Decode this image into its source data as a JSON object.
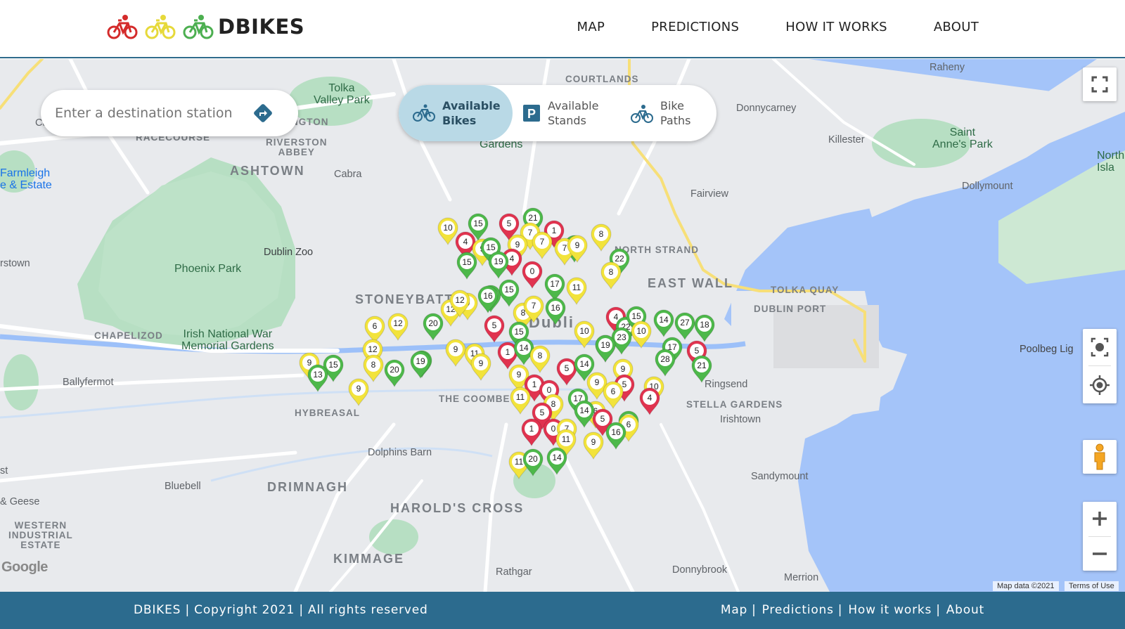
{
  "header": {
    "brand": "DBIKES",
    "logo_bike_colors": [
      "#d42b2b",
      "#e6d93a",
      "#4caf50"
    ],
    "nav": [
      "MAP",
      "PREDICTIONS",
      "HOW IT WORKS",
      "ABOUT"
    ]
  },
  "search": {
    "placeholder": "Enter a destination station",
    "icon": "directions-icon"
  },
  "layers": [
    {
      "icon": "bicycle-icon",
      "label_line1": "Available",
      "label_line2": "Bikes",
      "active": true
    },
    {
      "icon": "parking-icon",
      "label_line1": "Available",
      "label_line2": "Stands",
      "active": false
    },
    {
      "icon": "bike-path-icon",
      "label_line1": "Bike",
      "label_line2": "Paths",
      "active": false
    }
  ],
  "marker_colors": {
    "red": "#e0334f",
    "yellow": "#f2e33b",
    "green": "#4db84a"
  },
  "map_labels": {
    "courtlands": "COURTLANDS",
    "raheny": "Raheny",
    "tolka_valley": "Tolka\nValley Park",
    "donnycarney": "Donnycarney",
    "killester": "Killester",
    "saint_annes": "Saint\nAnne's Park",
    "north_island": "North\nIsla",
    "dollymount": "Dollymount",
    "racecourse": "RACECOURSE",
    "riverston": "RIVERSTON\nABBEY",
    "ashtown": "ASHTOWN",
    "cabra": "Cabra",
    "farmleigh": "Farmleigh\ne & Estate",
    "gardens": "Gardens",
    "fairview": "Fairview",
    "dublin_zoo": "Dublin Zoo",
    "phoenix_park": "Phoenix Park",
    "north_strand": "NORTH STRAND",
    "east_wall": "EAST WALL",
    "tolka_quay": "TOLKA QUAY",
    "dublin_port": "DUBLIN PORT",
    "stoneybatter": "STONEYBATT",
    "dublin": "Dubli",
    "chapelizod": "CHAPELIZOD",
    "war_memorial": "Irish National War\nMemorial Gardens",
    "poolbeg": "Poolbeg Lig",
    "ballyfermot": "Ballyfermot",
    "hybreasal": "HYBREASAL",
    "the_coombe": "THE COOMBE",
    "ringsend": "Ringsend",
    "stella_gardens": "STELLA GARDENS",
    "irishtown": "Irishtown",
    "dolphins_barn": "Dolphins Barn",
    "bluebell": "Bluebell",
    "drimnagh": "DRIMNAGH",
    "sandymount": "Sandymount",
    "geese": "& Geese",
    "western": "WESTERN\nINDUSTRIAL\nESTATE",
    "harolds_cross": "HAROLD'S CROSS",
    "kimmage": "KIMMAGE",
    "rathgar": "Rathgar",
    "donnybrook": "Donnybrook",
    "merrion": "Merrion",
    "rstown": "rstown",
    "st": "st",
    "ngton": "NGTON",
    "ca": "Ca",
    "google": "Google"
  },
  "attribution": {
    "map_data": "Map data ©2021",
    "terms": "Terms of Use"
  },
  "controls": [
    "fullscreen-button",
    "camera-control-button",
    "my-location-button",
    "street-view-pegman",
    "zoom-in-button",
    "zoom-out-button"
  ],
  "stations": [
    [
      "y",
      10
    ],
    [
      "g",
      15
    ],
    [
      "r",
      5
    ],
    [
      "g",
      21
    ],
    [
      "y",
      7
    ],
    [
      "r",
      1
    ],
    [
      "y",
      9
    ],
    [
      "y",
      7
    ],
    [
      "g",
      15
    ],
    [
      "r",
      4
    ],
    [
      "y",
      9
    ],
    [
      "y",
      7
    ],
    [
      "y",
      9
    ],
    [
      "r",
      4
    ],
    [
      "r",
      0
    ],
    [
      "y",
      8
    ],
    [
      "g",
      22
    ],
    [
      "g",
      15
    ],
    [
      "g",
      19
    ],
    [
      "y",
      8
    ],
    [
      "g",
      15
    ],
    [
      "g",
      16
    ],
    [
      "g",
      15
    ],
    [
      "g",
      17
    ],
    [
      "y",
      11
    ],
    [
      "y",
      9
    ],
    [
      "g",
      16
    ],
    [
      "y",
      12
    ],
    [
      "y",
      8
    ],
    [
      "g",
      16
    ],
    [
      "y",
      12
    ],
    [
      "y",
      7
    ],
    [
      "r",
      4
    ],
    [
      "g",
      22
    ],
    [
      "g",
      15
    ],
    [
      "g",
      19
    ],
    [
      "g",
      14
    ],
    [
      "g",
      27
    ],
    [
      "g",
      18
    ],
    [
      "y",
      12
    ],
    [
      "g",
      20
    ],
    [
      "r",
      5
    ],
    [
      "g",
      15
    ],
    [
      "y",
      10
    ],
    [
      "y",
      10
    ],
    [
      "g",
      23
    ],
    [
      "g",
      19
    ],
    [
      "g",
      17
    ],
    [
      "r",
      5
    ],
    [
      "y",
      6
    ],
    [
      "y",
      12
    ],
    [
      "y",
      9
    ],
    [
      "y",
      11
    ],
    [
      "r",
      1
    ],
    [
      "g",
      14
    ],
    [
      "y",
      8
    ],
    [
      "g",
      28
    ],
    [
      "g",
      21
    ],
    [
      "g",
      19
    ],
    [
      "y",
      9
    ],
    [
      "g",
      15
    ],
    [
      "y",
      8
    ],
    [
      "g",
      20
    ],
    [
      "g",
      19
    ],
    [
      "g",
      13
    ],
    [
      "y",
      9
    ],
    [
      "r",
      5
    ],
    [
      "g",
      14
    ],
    [
      "y",
      9
    ],
    [
      "y",
      9
    ],
    [
      "y",
      9
    ],
    [
      "y",
      9
    ],
    [
      "r",
      5
    ],
    [
      "y",
      6
    ],
    [
      "y",
      10
    ],
    [
      "r",
      1
    ],
    [
      "r",
      0
    ],
    [
      "y",
      11
    ],
    [
      "g",
      17
    ],
    [
      "y",
      8
    ],
    [
      "y",
      6
    ],
    [
      "r",
      4
    ],
    [
      "g",
      14
    ],
    [
      "r",
      5
    ],
    [
      "g",
      14
    ],
    [
      "r",
      5
    ],
    [
      "y",
      6
    ],
    [
      "r",
      1
    ],
    [
      "r",
      0
    ],
    [
      "y",
      7
    ],
    [
      "y",
      11
    ],
    [
      "g",
      16
    ],
    [
      "y",
      9
    ],
    [
      "g",
      14
    ],
    [
      "y",
      11
    ],
    [
      "g",
      20
    ]
  ]
}
